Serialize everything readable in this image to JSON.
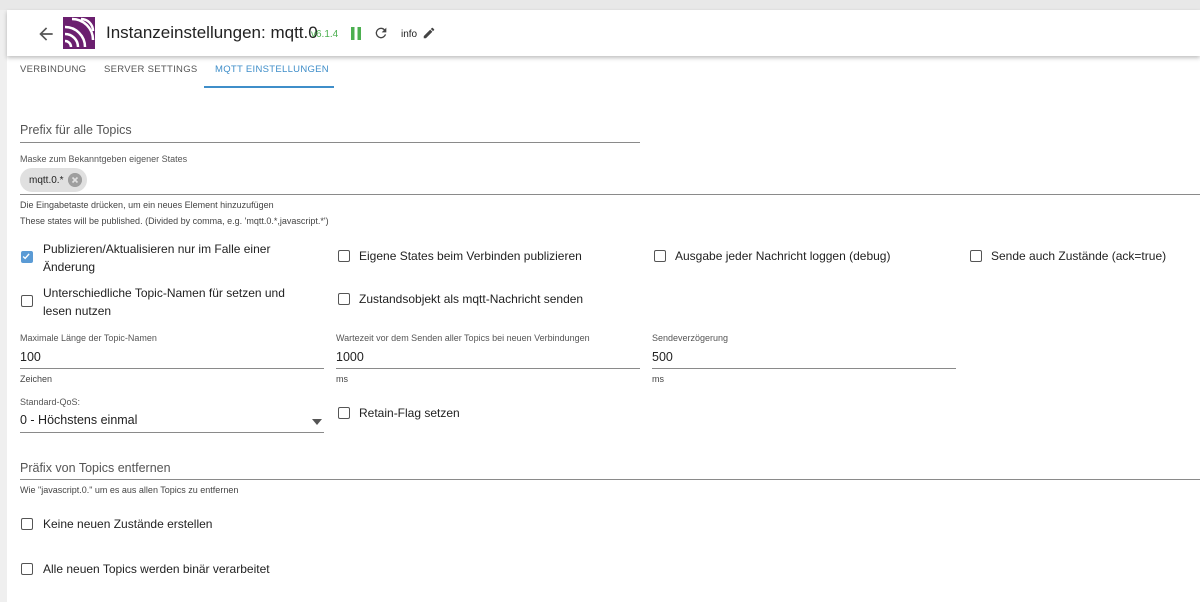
{
  "header": {
    "title": "Instanzeinstellungen: mqtt.0",
    "version": "v6.1.4",
    "info_label": "info"
  },
  "tabs": [
    {
      "label": "VERBINDUNG",
      "active": false
    },
    {
      "label": "SERVER SETTINGS",
      "active": false
    },
    {
      "label": "MQTT EINSTELLUNGEN",
      "active": true
    }
  ],
  "colors": {
    "accent": "#3f8ec9",
    "version": "#4caf50",
    "checkbox_checked": "#5b9bd5"
  },
  "prefix_field": {
    "placeholder": "Prefix für alle Topics"
  },
  "mask_field": {
    "label": "Maske zum Bekanntgeben eigener States",
    "chip": "mqtt.0.*",
    "helper1": "Die Eingabetaste drücken, um ein neues Element hinzuzufügen",
    "helper2": "These states will be published. (Divided by comma, e.g. 'mqtt.0.*,javascript.*')"
  },
  "checkboxes_row1": [
    {
      "label_line1": "Publizieren/Aktualisieren nur im Falle einer",
      "label_line2": "Änderung",
      "checked": true
    },
    {
      "label": "Eigene States beim Verbinden publizieren",
      "checked": false
    },
    {
      "label": "Ausgabe jeder Nachricht loggen (debug)",
      "checked": false
    },
    {
      "label": "Sende auch Zustände (ack=true)",
      "checked": false
    }
  ],
  "checkboxes_row2": [
    {
      "label_line1": "Unterschiedliche Topic-Namen für setzen und",
      "label_line2": "lesen nutzen",
      "checked": false
    },
    {
      "label": "Zustandsobjekt als mqtt-Nachricht senden",
      "checked": false
    }
  ],
  "fields": {
    "max_len": {
      "label": "Maximale Länge der Topic-Namen",
      "value": "100",
      "helper": "Zeichen"
    },
    "wait_time": {
      "label": "Wartezeit vor dem Senden aller Topics bei neuen Verbindungen",
      "value": "1000",
      "helper": "ms"
    },
    "send_delay": {
      "label": "Sendeverzögerung",
      "value": "500",
      "helper": "ms"
    }
  },
  "qos": {
    "label": "Standard-QoS:",
    "value": "0 - Höchstens einmal"
  },
  "retain": {
    "label": "Retain-Flag setzen",
    "checked": false
  },
  "remove_prefix": {
    "placeholder": "Präfix von Topics entfernen",
    "helper": "Wie \"javascript.0.\" um es aus allen Topics zu entfernen"
  },
  "no_new_states": {
    "label": "Keine neuen Zustände erstellen",
    "checked": false
  },
  "binary_topics": {
    "label": "Alle neuen Topics werden binär verarbeitet",
    "checked": false
  }
}
